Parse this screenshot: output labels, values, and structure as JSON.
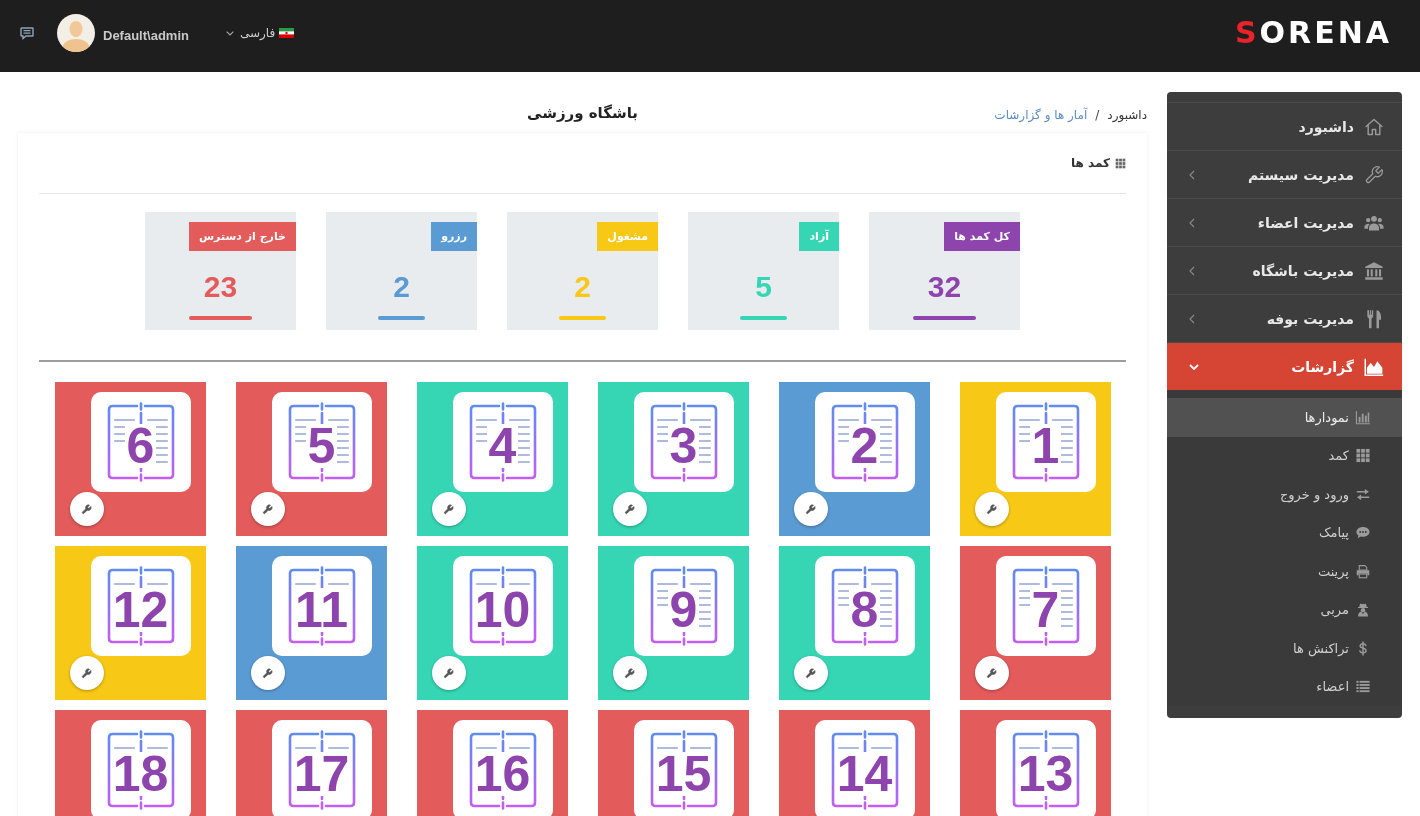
{
  "header": {
    "logo": "SORENA",
    "language": "فارسی",
    "user": "Default\\admin"
  },
  "sidebar": {
    "items": [
      {
        "label": "داشبورد",
        "kind": "link",
        "selected": false
      },
      {
        "label": "مدیریت سیستم",
        "kind": "group",
        "selected": false,
        "expanded": false
      },
      {
        "label": "مدیریت اعضاء",
        "kind": "group",
        "selected": false,
        "expanded": false
      },
      {
        "label": "مدیریت باشگاه",
        "kind": "group",
        "selected": false,
        "expanded": false
      },
      {
        "label": "مدیریت بوفه",
        "kind": "group",
        "selected": false,
        "expanded": false
      },
      {
        "label": "گزارشات",
        "kind": "group",
        "selected": true,
        "expanded": true,
        "children": [
          {
            "label": "نمودارها",
            "selected": true
          },
          {
            "label": "کمد",
            "selected": false
          },
          {
            "label": "ورود و خروج",
            "selected": false
          },
          {
            "label": "پیامک",
            "selected": false
          },
          {
            "label": "پرینت",
            "selected": false
          },
          {
            "label": "مربی",
            "selected": false
          },
          {
            "label": "تراکنش ها",
            "selected": false
          },
          {
            "label": "اعضاء",
            "selected": false
          }
        ]
      }
    ]
  },
  "breadcrumb": {
    "items": [
      {
        "text": "داشبورد",
        "link": false
      },
      {
        "text": "آمار ها و گزارشات",
        "link": true
      }
    ],
    "separator": "/"
  },
  "page_title": "باشگاه ورزشی",
  "card": {
    "title": "کمد ها",
    "stats": [
      {
        "label": "کل کمد ها",
        "value": "32",
        "color": "#8e44ad"
      },
      {
        "label": "آزاد",
        "value": "5",
        "color": "#36d6b5"
      },
      {
        "label": "مشغول",
        "value": "2",
        "color": "#f7c815"
      },
      {
        "label": "رزرو",
        "value": "2",
        "color": "#5b9bd3"
      },
      {
        "label": "خارج از دسترس",
        "value": "23",
        "color": "#e35b5a"
      }
    ],
    "lockers": [
      {
        "number": "1",
        "color": "#f7c815"
      },
      {
        "number": "2",
        "color": "#5b9bd3"
      },
      {
        "number": "3",
        "color": "#36d6b5"
      },
      {
        "number": "4",
        "color": "#36d6b5"
      },
      {
        "number": "5",
        "color": "#e35b5a"
      },
      {
        "number": "6",
        "color": "#e35b5a"
      },
      {
        "number": "7",
        "color": "#e35b5a"
      },
      {
        "number": "8",
        "color": "#36d6b5"
      },
      {
        "number": "9",
        "color": "#36d6b5"
      },
      {
        "number": "10",
        "color": "#36d6b5"
      },
      {
        "number": "11",
        "color": "#5b9bd3"
      },
      {
        "number": "12",
        "color": "#f7c815"
      },
      {
        "number": "13",
        "color": "#e35b5a"
      },
      {
        "number": "14",
        "color": "#e35b5a"
      },
      {
        "number": "15",
        "color": "#e35b5a"
      },
      {
        "number": "16",
        "color": "#e35b5a"
      },
      {
        "number": "17",
        "color": "#e35b5a"
      },
      {
        "number": "18",
        "color": "#e35b5a"
      }
    ]
  }
}
